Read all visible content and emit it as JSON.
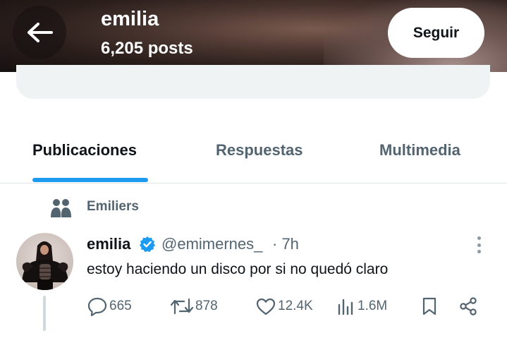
{
  "header": {
    "name": "emilia",
    "posts_count": "6,205 posts",
    "follow_label": "Seguir",
    "back_icon": "arrow-left-icon"
  },
  "tabs": [
    {
      "label": "Publicaciones",
      "active": true
    },
    {
      "label": "Respuestas",
      "active": false
    },
    {
      "label": "Multimedia",
      "active": false
    }
  ],
  "context": {
    "icon": "community-icon",
    "label": "Emiliers"
  },
  "tweet": {
    "author": "emilia",
    "handle": "@emimernes_",
    "time": "· 7h",
    "text": "estoy haciendo un disco por si no quedó claro",
    "verified": true,
    "actions": {
      "replies": "665",
      "reposts": "878",
      "likes": "12.4K",
      "views": "1.6M"
    }
  },
  "colors": {
    "accent": "#1d9bf0",
    "text_primary": "#0f1419",
    "text_secondary": "#536471"
  }
}
